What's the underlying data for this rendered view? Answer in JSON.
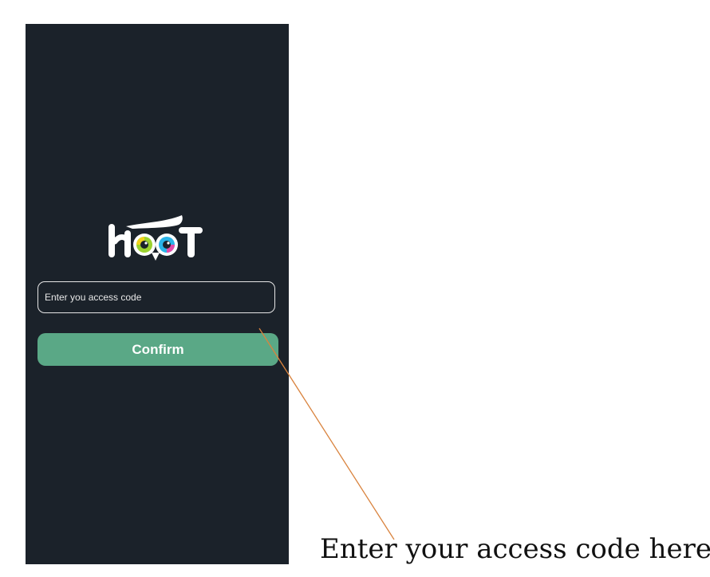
{
  "app": {
    "logo_text": "HOOT",
    "background_color": "#1b222a",
    "accent_color": "#5aa886"
  },
  "access_form": {
    "input_placeholder": "Enter you access code",
    "input_value": "",
    "confirm_label": "Confirm"
  },
  "annotation": {
    "text": "Enter your access code here",
    "arrow_color": "#d9833e"
  }
}
